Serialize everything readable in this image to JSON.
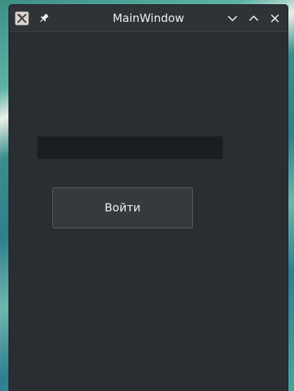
{
  "window": {
    "title": "MainWindow",
    "icons": {
      "app": "application-icon",
      "pin": "pin-icon",
      "minimize": "chevron-down-icon",
      "maximize": "chevron-up-icon",
      "close": "close-icon"
    }
  },
  "form": {
    "input_value": "",
    "input_placeholder": "",
    "login_label": "Войти"
  },
  "colors": {
    "window_bg": "#2a2e32",
    "titlebar_bg": "#2f3338",
    "input_bg": "#1b1e20",
    "button_bg": "#363a3f",
    "text": "#eff0f1"
  }
}
